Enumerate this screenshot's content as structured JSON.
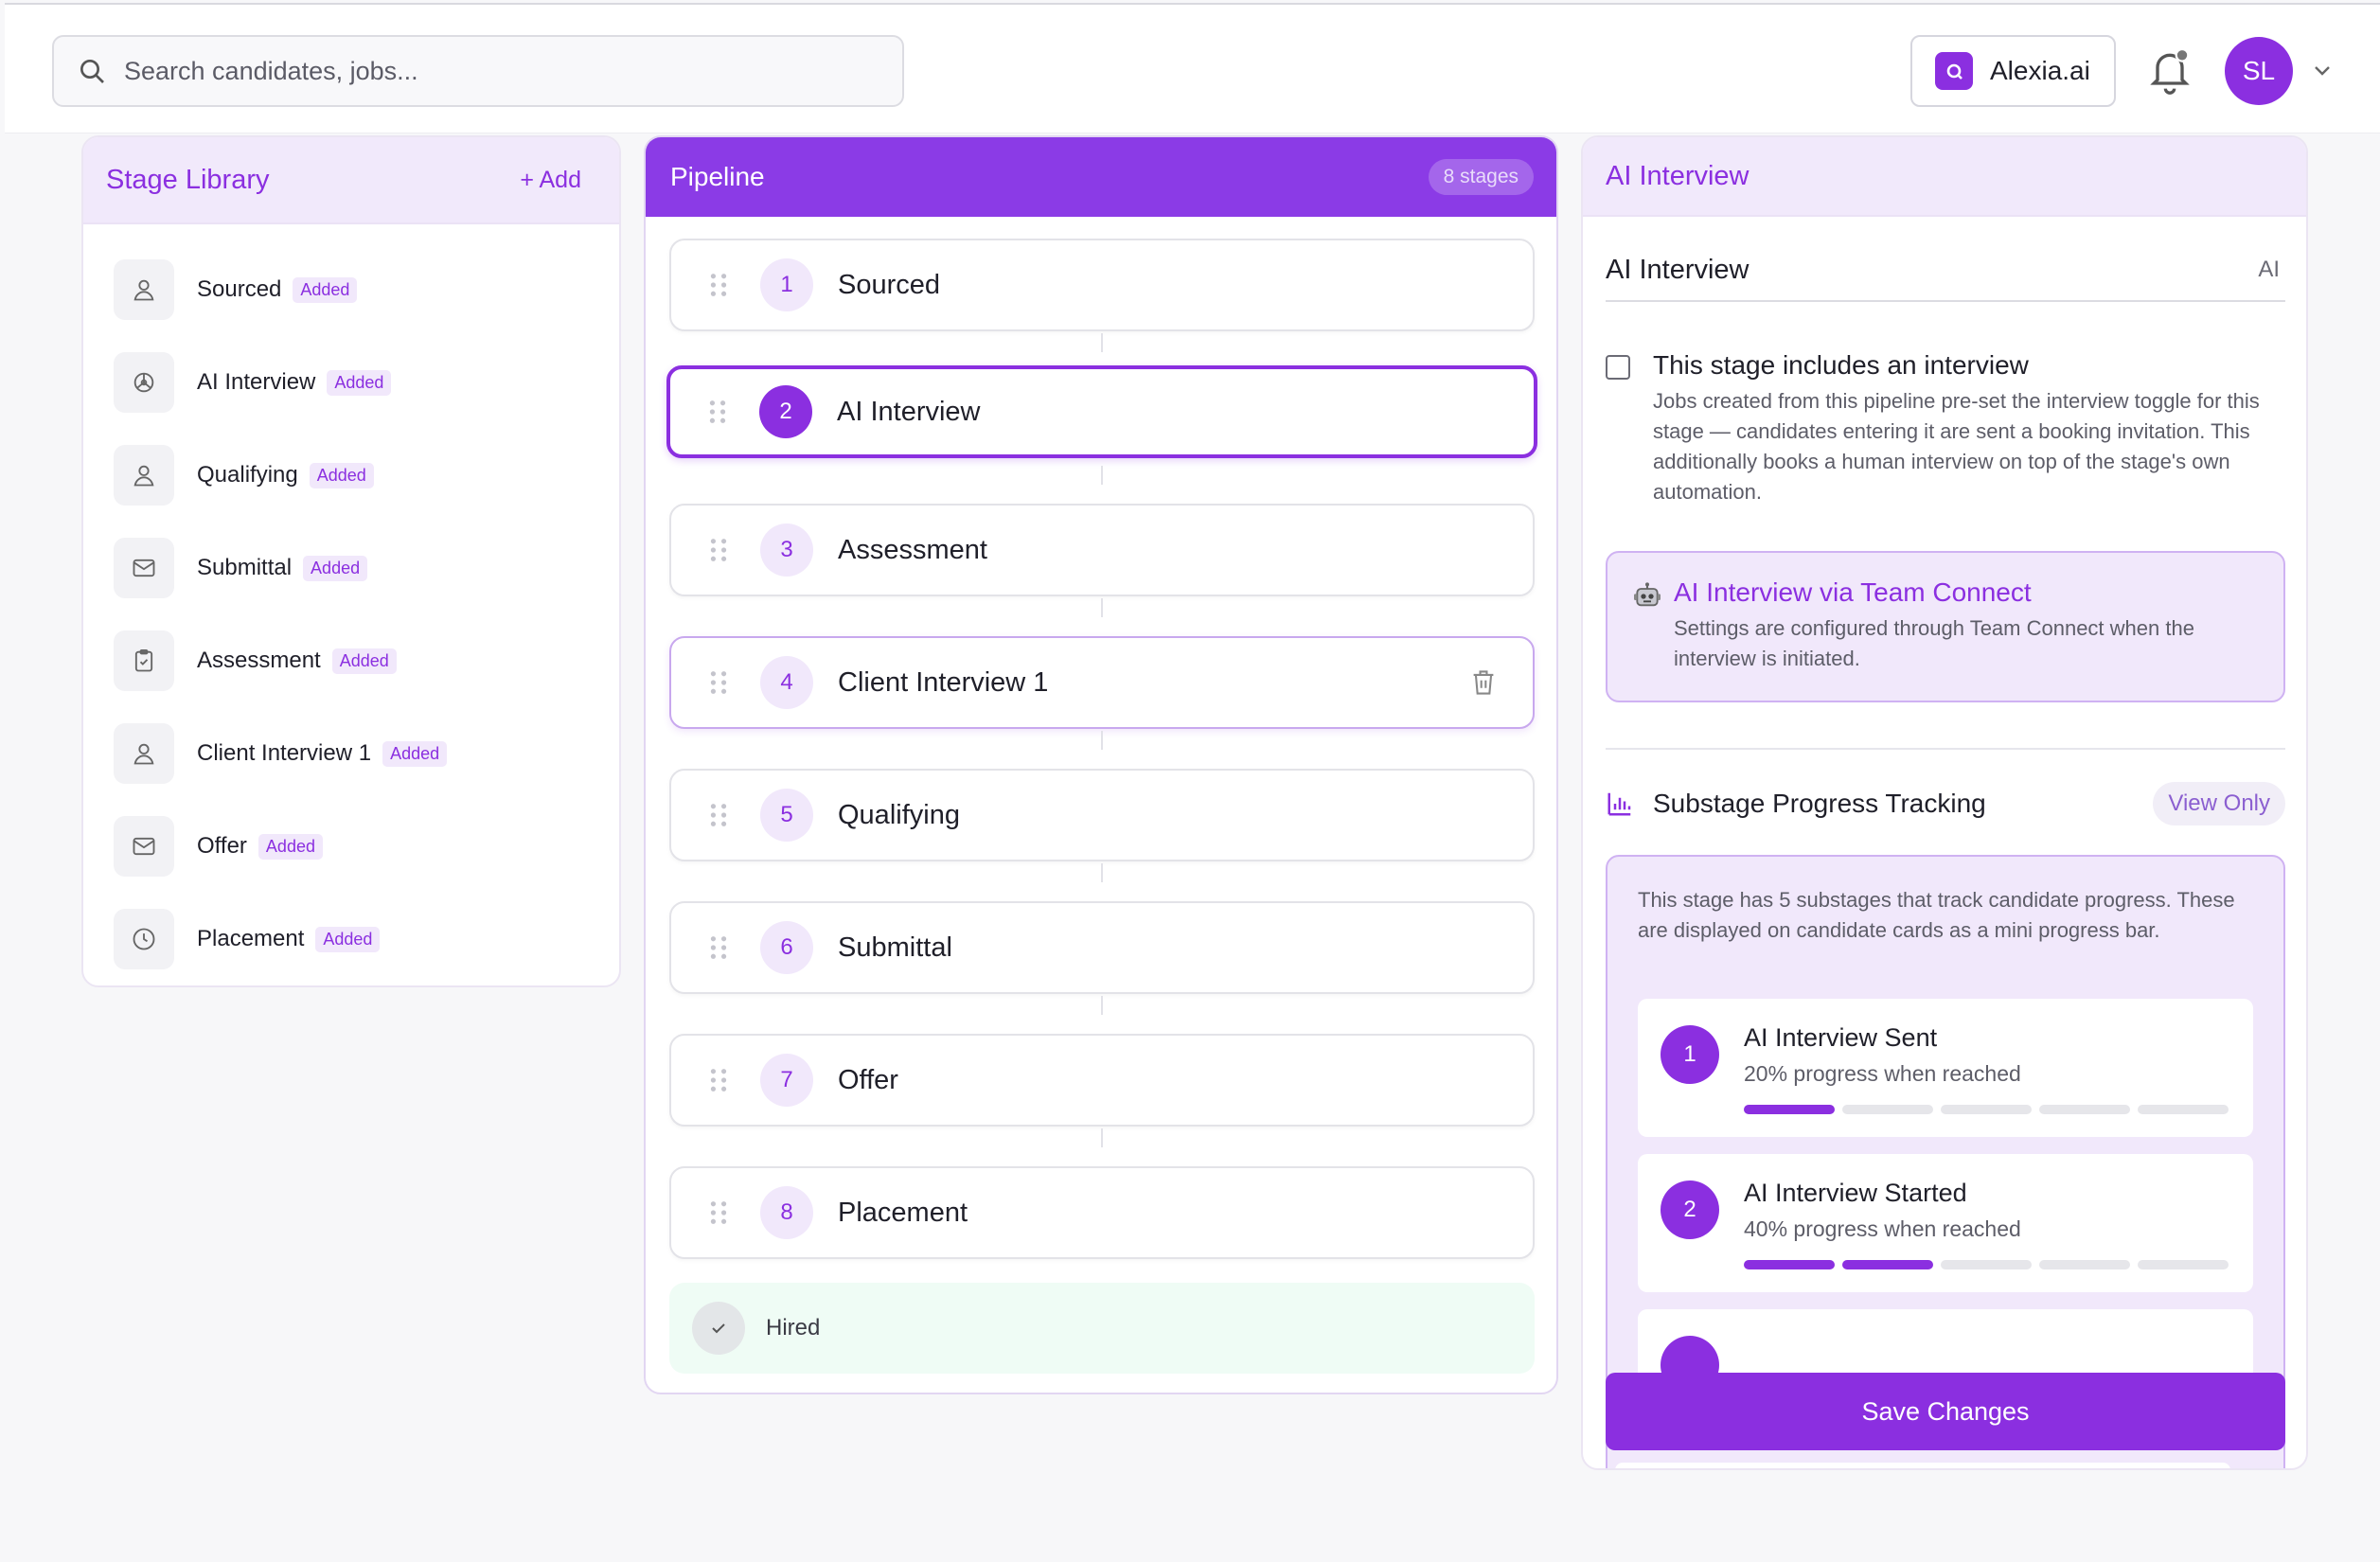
{
  "header": {
    "search_placeholder": "Search candidates, jobs...",
    "brand_name": "Alexia.ai",
    "avatar_initials": "SL"
  },
  "library": {
    "title": "Stage Library",
    "add_label": "+ Add",
    "badge_label": "Added",
    "items": [
      {
        "label": "Sourced",
        "icon": "user-icon"
      },
      {
        "label": "AI Interview",
        "icon": "ai-brain-icon"
      },
      {
        "label": "Qualifying",
        "icon": "user-icon"
      },
      {
        "label": "Submittal",
        "icon": "mail-icon"
      },
      {
        "label": "Assessment",
        "icon": "clipboard-check-icon"
      },
      {
        "label": "Client Interview 1",
        "icon": "user-icon"
      },
      {
        "label": "Offer",
        "icon": "mail-icon"
      },
      {
        "label": "Placement",
        "icon": "clock-icon"
      }
    ]
  },
  "pipeline": {
    "title": "Pipeline",
    "count_label": "8 stages",
    "stages": [
      {
        "num": "1",
        "name": "Sourced"
      },
      {
        "num": "2",
        "name": "AI Interview"
      },
      {
        "num": "3",
        "name": "Assessment"
      },
      {
        "num": "4",
        "name": "Client Interview 1"
      },
      {
        "num": "5",
        "name": "Qualifying"
      },
      {
        "num": "6",
        "name": "Submittal"
      },
      {
        "num": "7",
        "name": "Offer"
      },
      {
        "num": "8",
        "name": "Placement"
      }
    ],
    "selected_index": 1,
    "hover_index": 3,
    "final_stage": "Hired"
  },
  "detail": {
    "title": "AI Interview",
    "stage_name": "AI Interview",
    "stage_tag": "AI",
    "interview_checkbox": {
      "checked": false,
      "label": "This stage includes an interview",
      "description": "Jobs created from this pipeline pre-set the interview toggle for this stage — candidates entering it are sent a booking invitation. This additionally books a human interview on top of the stage's own automation."
    },
    "team_connect": {
      "title": "AI Interview via Team Connect",
      "description": "Settings are configured through Team Connect when the interview is initiated."
    },
    "substage": {
      "title": "Substage Progress Tracking",
      "view_only_label": "View Only",
      "description": "This stage has 5 substages that track candidate progress. These are displayed on candidate cards as a mini progress bar.",
      "items": [
        {
          "num": "1",
          "name": "AI Interview Sent",
          "progress_text": "20% progress when reached",
          "progress_fraction": 0.2
        },
        {
          "num": "2",
          "name": "AI Interview Started",
          "progress_text": "40% progress when reached",
          "progress_fraction": 0.4
        }
      ]
    },
    "save_label": "Save Changes"
  },
  "colors": {
    "accent": "#8b2fe0",
    "accent_light": "#f1e8fb",
    "hired_bg": "#effcf5"
  }
}
